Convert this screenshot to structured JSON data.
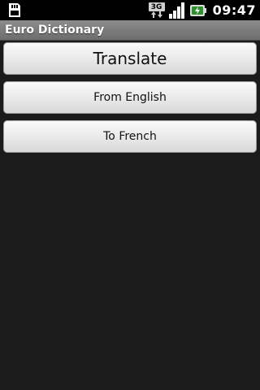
{
  "status_bar": {
    "network_label": "3G",
    "time": "09:47",
    "icons": {
      "left": "sd-card-icon",
      "network": "3g-network-icon",
      "signal": "signal-strength-icon",
      "battery": "battery-charging-icon"
    }
  },
  "app": {
    "title": "Euro Dictionary"
  },
  "buttons": {
    "translate": "Translate",
    "from": "From English",
    "to": "To French"
  },
  "colors": {
    "background": "#1b1b1b",
    "title_bar": "#7a7a7a",
    "button_face": "#ececec"
  }
}
